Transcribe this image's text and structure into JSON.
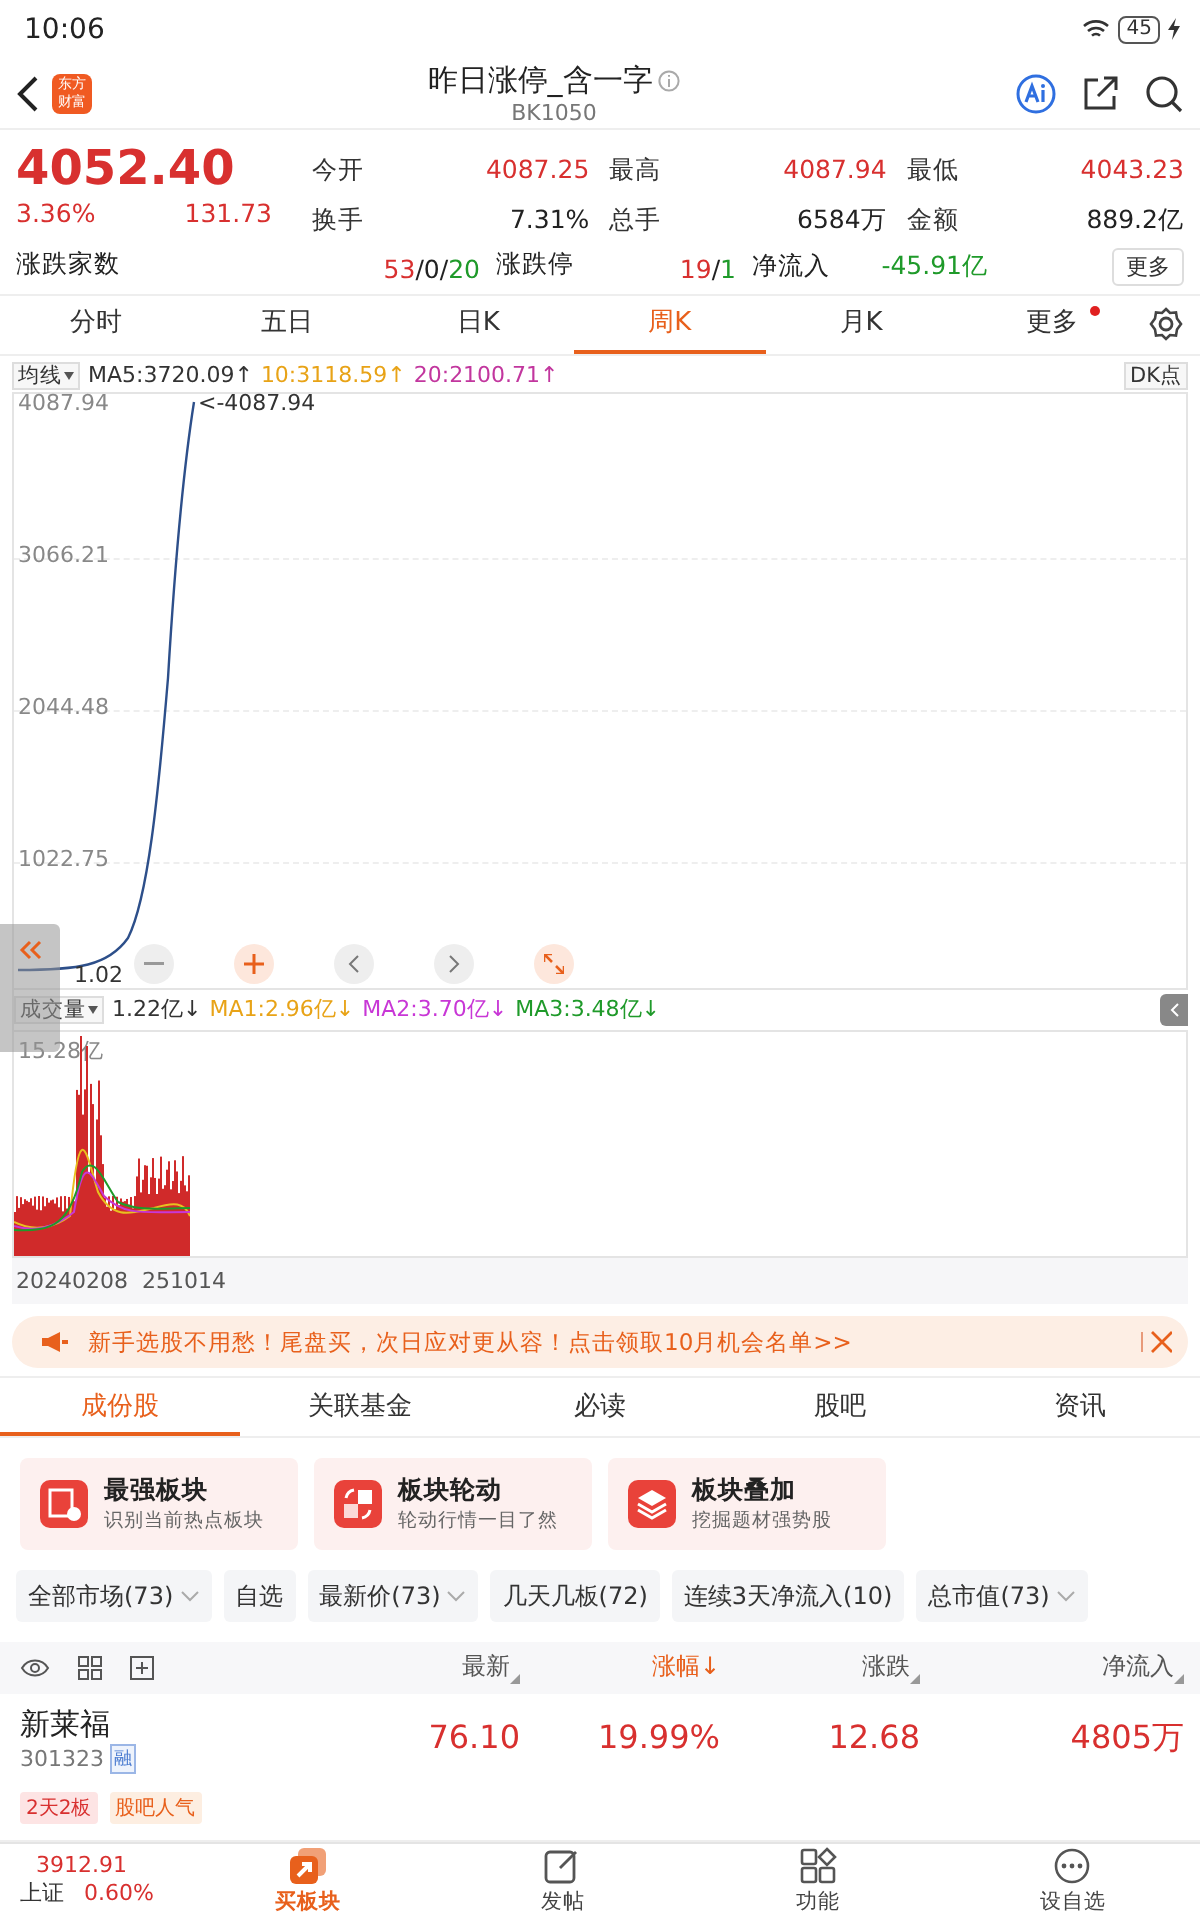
{
  "status_bar": {
    "time": "10:06",
    "battery": "45"
  },
  "header": {
    "title": "昨日涨停_含一字",
    "code": "BK1050",
    "logo": "东方财富"
  },
  "quote": {
    "price": "4052.40",
    "change_pct": "3.36%",
    "change": "131.73",
    "fields": [
      {
        "label": "今开",
        "value": "4087.25",
        "color": "#d8302f"
      },
      {
        "label": "最高",
        "value": "4087.94",
        "color": "#d8302f"
      },
      {
        "label": "最低",
        "value": "4043.23",
        "color": "#d8302f"
      },
      {
        "label": "换手",
        "value": "7.31%",
        "color": "#222222"
      },
      {
        "label": "总手",
        "value": "6584万",
        "color": "#222222"
      },
      {
        "label": "金额",
        "value": "889.2亿",
        "color": "#222222"
      }
    ],
    "breadth": {
      "label": "涨跌家数",
      "parts": [
        {
          "text": "53",
          "color": "#d8302f"
        },
        {
          "text": "/0/",
          "color": "#222222"
        },
        {
          "text": "20",
          "color": "#1f9a2a"
        }
      ]
    },
    "limits": {
      "label": "涨跌停",
      "parts": [
        {
          "text": "19",
          "color": "#d8302f"
        },
        {
          "text": "/",
          "color": "#222222"
        },
        {
          "text": "1",
          "color": "#1f9a2a"
        }
      ]
    },
    "inflow": {
      "label": "净流入",
      "value": "-45.91亿",
      "color": "#1f9a2a"
    },
    "more": "更多"
  },
  "period_tabs": [
    {
      "label": "分时",
      "selected": false,
      "badge": false
    },
    {
      "label": "五日",
      "selected": false,
      "badge": false
    },
    {
      "label": "日K",
      "selected": false,
      "badge": false
    },
    {
      "label": "周K",
      "selected": true,
      "badge": false
    },
    {
      "label": "月K",
      "selected": false,
      "badge": false
    },
    {
      "label": "更多",
      "selected": false,
      "badge": true
    }
  ],
  "ma_bar": {
    "selector": "均线",
    "items": [
      {
        "text": "MA5:3720.09↑",
        "color": "#333333"
      },
      {
        "text": "10:3118.59↑",
        "color": "#e8a317"
      },
      {
        "text": "20:2100.71↑",
        "color": "#c2369e"
      }
    ],
    "dk": "DK点"
  },
  "price_chart": {
    "y_ticks": [
      "4087.94",
      "3066.21",
      "2044.48",
      "1022.75"
    ],
    "peak_label": "<-4087.94",
    "low_label": "1.02"
  },
  "volume_bar": {
    "selector": "成交量",
    "items": [
      {
        "text": "1.22亿↓",
        "color": "#333333"
      },
      {
        "text": "MA1:2.96亿↓",
        "color": "#e8a317"
      },
      {
        "text": "MA2:3.70亿↓",
        "color": "#c837d6"
      },
      {
        "text": "MA3:3.48亿↓",
        "color": "#1f9a2a"
      }
    ]
  },
  "volume_chart": {
    "top_label": "15.28亿",
    "dates": [
      "20240208",
      "251014"
    ]
  },
  "banner": {
    "text": "新手选股不用愁！尾盘买，次日应对更从容！点击领取10月机会名单>>"
  },
  "sub_tabs": [
    {
      "label": "成份股",
      "selected": true
    },
    {
      "label": "关联基金",
      "selected": false
    },
    {
      "label": "必读",
      "selected": false
    },
    {
      "label": "股吧",
      "selected": false
    },
    {
      "label": "资讯",
      "selected": false
    }
  ],
  "feature_cards": [
    {
      "kind": "board",
      "title": "最强板块",
      "subtitle": "识别当前热点板块"
    },
    {
      "kind": "rotate",
      "title": "板块轮动",
      "subtitle": "轮动行情一目了然"
    },
    {
      "kind": "layers",
      "title": "板块叠加",
      "subtitle": "挖掘题材强势股"
    }
  ],
  "filters": [
    {
      "label": "全部市场(73)",
      "dropdown": true
    },
    {
      "label": "自选",
      "dropdown": false
    },
    {
      "label": "最新价(73)",
      "dropdown": true
    },
    {
      "label": "几天几板(72)",
      "dropdown": false
    },
    {
      "label": "连续3天净流入(10)",
      "dropdown": false
    },
    {
      "label": "总市值(73)",
      "dropdown": true
    }
  ],
  "table": {
    "columns": [
      {
        "label": "最新",
        "active": false
      },
      {
        "label": "涨幅↓",
        "active": true
      },
      {
        "label": "涨跌",
        "active": false
      },
      {
        "label": "净流入",
        "active": false
      }
    ],
    "rows": [
      {
        "name": "新莱福",
        "code": "301323",
        "margin": "融",
        "tags": [
          {
            "text": "2天2板",
            "kind": "limit"
          },
          {
            "text": "股吧人气",
            "kind": "hot"
          }
        ],
        "values": [
          "76.10",
          "19.99%",
          "12.68",
          "4805万"
        ]
      }
    ]
  },
  "bottom_nav": {
    "index": {
      "value": "3912.91",
      "name": "上证",
      "pct": "0.60%"
    },
    "items": [
      {
        "kind": "buy",
        "label": "买板块",
        "selected": true
      },
      {
        "kind": "post",
        "label": "发帖",
        "selected": false
      },
      {
        "kind": "grid",
        "label": "功能",
        "selected": false
      },
      {
        "kind": "more",
        "label": "设自选",
        "selected": false
      }
    ]
  }
}
